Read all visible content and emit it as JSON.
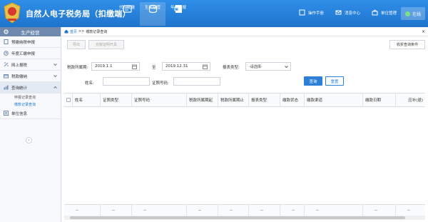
{
  "header": {
    "title": "自然人电子税务局（扣缴端）",
    "nav": [
      {
        "label": "代扣代缴",
        "icon": "withholding-icon",
        "active": false
      },
      {
        "label": "生产经营",
        "icon": "business-icon",
        "active": true
      },
      {
        "label": "年度申报",
        "icon": "annual-report-icon",
        "active": false
      }
    ],
    "tools": [
      {
        "label": "操作手册",
        "icon": "manual-icon"
      },
      {
        "label": "消息中心",
        "icon": "message-icon"
      },
      {
        "label": "单位管理",
        "icon": "unit-icon"
      }
    ],
    "status": "在线"
  },
  "sidebar": {
    "heading": "生产经营",
    "items": [
      {
        "label": "预缴纳税申报",
        "icon": "declare-icon"
      },
      {
        "label": "年度汇缴申报",
        "icon": "annual-icon"
      },
      {
        "label": "网上报税",
        "icon": "online-tax-icon",
        "chevron": true
      },
      {
        "label": "税款缴纳",
        "icon": "tax-pay-icon",
        "chevron": true
      },
      {
        "label": "查询统计",
        "icon": "query-icon",
        "chevron": true,
        "open": true
      },
      {
        "label": "单位信息",
        "icon": "unit-info-icon"
      }
    ],
    "subitems": [
      {
        "label": "申报记录查询",
        "active": false
      },
      {
        "label": "缴款记录查询",
        "active": true
      }
    ]
  },
  "breadcrumb": {
    "home": "首页",
    "sep": ">>",
    "current": "缴款记录查询"
  },
  "toolbar": {
    "export": "导出",
    "print_cert": "完税证明开具",
    "collapse": "收折查询条件"
  },
  "filters": {
    "period_label": "税款所属期:",
    "period_from": "2019.1.1",
    "to_label": "至",
    "period_to": "2019.12.31",
    "report_type_label": "报表类型:",
    "report_type_value": "-请选择-",
    "name_label": "姓名:",
    "name_value": "",
    "id_label": "证照号码:",
    "id_value": "",
    "query_btn": "查询",
    "reset_btn": "重置"
  },
  "table": {
    "columns": [
      "姓名",
      "证照类型",
      "证照号码",
      "税款所属期起",
      "税款所属期止",
      "报表类型",
      "缴款状态",
      "缴款渠道",
      "缴款日期",
      "应补(退)"
    ],
    "footer": [
      "--",
      "--",
      "--",
      "--",
      "--",
      "--",
      "--",
      "--",
      "--",
      "--"
    ]
  },
  "colors": {
    "brand": "#1f74cc",
    "accent": "#2d7fd8"
  }
}
